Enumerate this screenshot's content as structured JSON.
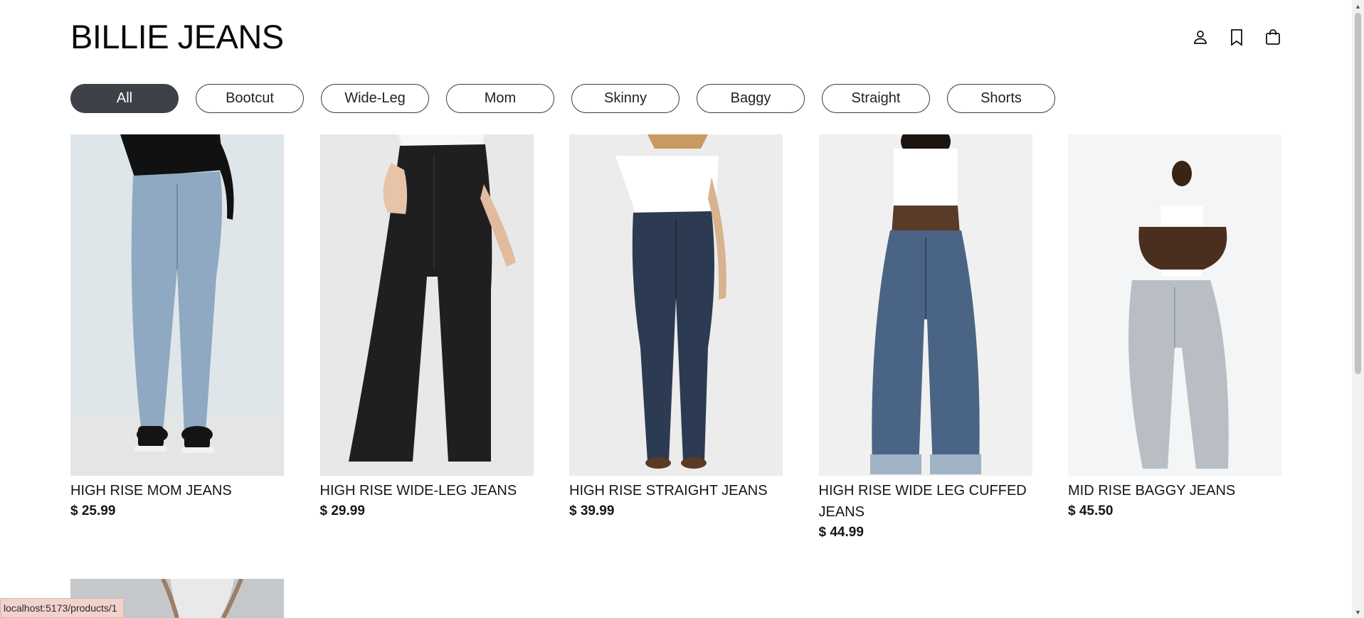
{
  "header": {
    "logo": "BILLIE JEANS",
    "icons": [
      "user-icon",
      "bookmark-icon",
      "shopping-bag-icon"
    ]
  },
  "filters": [
    {
      "label": "All",
      "active": true
    },
    {
      "label": "Bootcut",
      "active": false
    },
    {
      "label": "Wide-Leg",
      "active": false
    },
    {
      "label": "Mom",
      "active": false
    },
    {
      "label": "Skinny",
      "active": false
    },
    {
      "label": "Baggy",
      "active": false
    },
    {
      "label": "Straight",
      "active": false
    },
    {
      "label": "Shorts",
      "active": false
    }
  ],
  "products": [
    {
      "name": "HIGH RISE MOM JEANS",
      "price": "$ 25.99"
    },
    {
      "name": "HIGH RISE WIDE-LEG JEANS",
      "price": "$ 29.99"
    },
    {
      "name": "HIGH RISE STRAIGHT JEANS",
      "price": "$ 39.99"
    },
    {
      "name": "HIGH RISE WIDE LEG CUFFED JEANS",
      "price": "$ 44.99"
    },
    {
      "name": "MID RISE BAGGY JEANS",
      "price": "$ 45.50"
    }
  ],
  "status_url": "localhost:5173/products/1",
  "colors": {
    "active_pill": "#3f4148",
    "pill_border": "#3a3b40",
    "light_denim": "#8fa9c2",
    "black_denim": "#1f1f22",
    "dark_denim": "#2c3a52",
    "mid_denim": "#4a6485",
    "grey_denim": "#b8bec3"
  }
}
